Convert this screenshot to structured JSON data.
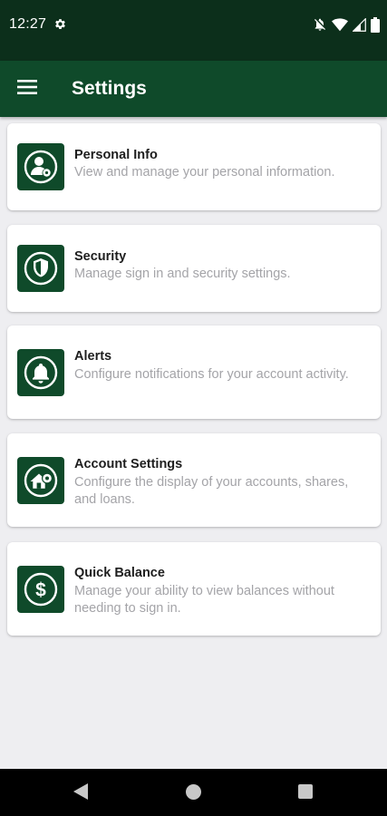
{
  "status_bar": {
    "time": "12:27",
    "icons": [
      "settings-icon",
      "notifications-off-icon",
      "wifi-icon",
      "signal-icon",
      "battery-icon"
    ]
  },
  "app_bar": {
    "title": "Settings",
    "menu_icon": "hamburger-menu-icon"
  },
  "colors": {
    "brand_dark": "#0c2f1b",
    "brand": "#0f4a2a",
    "background": "#eeeef1",
    "title_text": "#1e1e1e",
    "description_text": "#a4a4a8"
  },
  "settings_items": [
    {
      "title": "Personal Info",
      "description": "View and manage your personal information.",
      "icon": "person-icon"
    },
    {
      "title": "Security",
      "description": "Manage sign in and security settings.",
      "icon": "shield-icon"
    },
    {
      "title": "Alerts",
      "description": "Configure notifications for your account activity.",
      "icon": "bell-icon"
    },
    {
      "title": "Account Settings",
      "description": "Configure the display of your accounts, shares, and loans.",
      "icon": "house-gear-icon"
    },
    {
      "title": "Quick Balance",
      "description": "Manage your ability to view balances without needing to sign in.",
      "icon": "dollar-icon"
    }
  ],
  "nav_bar": {
    "icons": [
      "back-icon",
      "home-icon",
      "recents-icon"
    ]
  }
}
